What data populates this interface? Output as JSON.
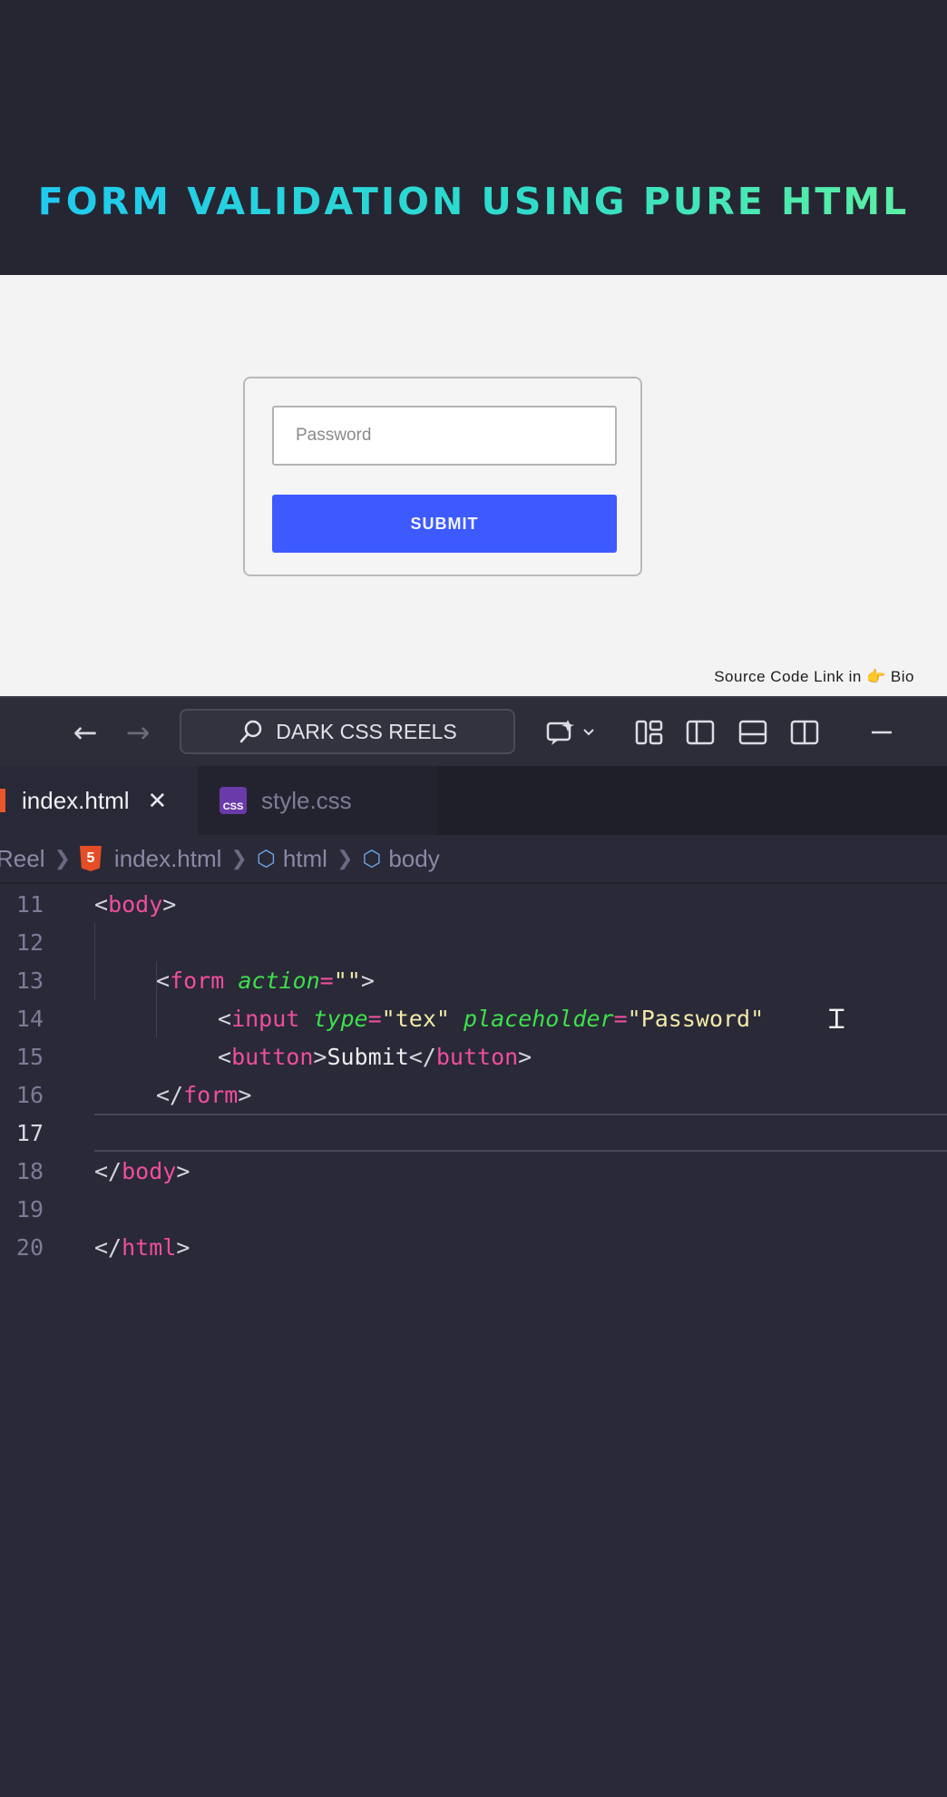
{
  "banner": {
    "title": "FORM VALIDATION USING PURE HTML"
  },
  "preview": {
    "password_placeholder": "Password",
    "submit_label": "SUBMIT",
    "source_note": "Source Code Link in 👉 Bio"
  },
  "titlebar": {
    "back_icon": "←",
    "forward_icon": "→",
    "search_label": "DARK CSS REELS"
  },
  "tabs": {
    "active_label": "index.html",
    "close_glyph": "✕",
    "inactive_label": "style.css",
    "css_badge": "CSS"
  },
  "breadcrumb": {
    "root": "Reel",
    "file": "index.html",
    "html5_badge": "5",
    "node1": "html",
    "node2": "body"
  },
  "code": {
    "line_numbers": [
      "11",
      "12",
      "13",
      "14",
      "15",
      "16",
      "17",
      "18",
      "19",
      "20"
    ],
    "l11": {
      "open": "<",
      "tag": "body",
      "close": ">"
    },
    "l13": {
      "open": "<",
      "tag": "form",
      "attr": "action",
      "eq": "=",
      "val": "\"\"",
      "close": ">"
    },
    "l14": {
      "open": "<",
      "tag": "input",
      "attr1": "type",
      "eq1": "=",
      "val1": "\"tex\"",
      "attr2": "placeholder",
      "eq2": "=",
      "val2": "\"Password\""
    },
    "l15": {
      "open": "<",
      "tag": "button",
      "close": ">",
      "text": "Submit",
      "end_open": "</",
      "end_tag": "button",
      "end_close": ">"
    },
    "l16": {
      "open": "</",
      "tag": "form",
      "close": ">"
    },
    "l18": {
      "open": "</",
      "tag": "body",
      "close": ">"
    },
    "l20": {
      "open": "</",
      "tag": "html",
      "close": ">"
    }
  },
  "colors": {
    "tag": "#ef4e9c",
    "attribute": "#3de04a",
    "string": "#f3e9a8",
    "submit_button": "#3d5afe"
  }
}
